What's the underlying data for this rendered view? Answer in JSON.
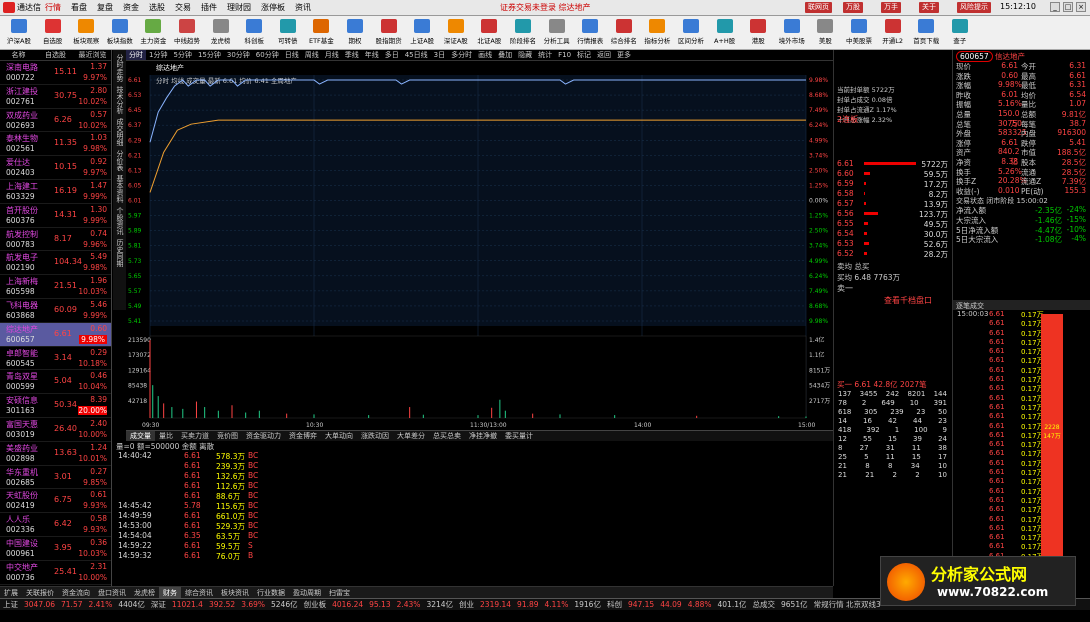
{
  "app": {
    "name": "通达信",
    "nav": "<<"
  },
  "menu": [
    "行情",
    "看盘",
    "复盘",
    "资金",
    "选股",
    "交易",
    "插件",
    "理财园",
    "涨停板",
    "资讯"
  ],
  "notice": "证券交易未登录  综达地产",
  "title_buttons": [
    "联网页",
    "万股",
    "万手",
    "关于",
    "风险提示"
  ],
  "clock": "15:12:10",
  "toolbar": [
    {
      "label": "沪深A股",
      "color": "#3a7bd5"
    },
    {
      "label": "自选股",
      "color": "#d33"
    },
    {
      "label": "板块观察",
      "color": "#e80"
    },
    {
      "label": "板块指数",
      "color": "#3a7bd5"
    },
    {
      "label": "主力资金",
      "color": "#6a4"
    },
    {
      "label": "中线趋势",
      "color": "#c44"
    },
    {
      "label": "龙虎榜",
      "color": "#888"
    },
    {
      "label": "科创板",
      "color": "#3a7bd5"
    },
    {
      "label": "可转债",
      "color": "#29a"
    },
    {
      "label": "ETF基金",
      "color": "#d60"
    },
    {
      "label": "期权",
      "color": "#3a7bd5"
    },
    {
      "label": "股指期货",
      "color": "#c33"
    },
    {
      "label": "上证A股",
      "color": "#3a7bd5"
    },
    {
      "label": "深证A股",
      "color": "#e80"
    },
    {
      "label": "北证A股",
      "color": "#c33"
    },
    {
      "label": "阶段排名",
      "color": "#29a"
    },
    {
      "label": "分析工具",
      "color": "#888"
    },
    {
      "label": "行情报表",
      "color": "#3a7bd5"
    },
    {
      "label": "综合排名",
      "color": "#c33"
    },
    {
      "label": "指标分析",
      "color": "#e80"
    },
    {
      "label": "区间分析",
      "color": "#3a7bd5"
    },
    {
      "label": "A+H股",
      "color": "#29a"
    },
    {
      "label": "港股",
      "color": "#c33"
    },
    {
      "label": "境外市场",
      "color": "#3a7bd5"
    },
    {
      "label": "美股",
      "color": "#888"
    },
    {
      "label": "中美股票",
      "color": "#3a7bd5"
    },
    {
      "label": "开通L2",
      "color": "#c33"
    },
    {
      "label": "首页下载",
      "color": "#3a7bd5"
    },
    {
      "label": "查子",
      "color": "#29a"
    }
  ],
  "leftlist": {
    "headers": [
      "名称",
      "自选股",
      "最近浏览"
    ],
    "items": [
      {
        "name": "深南电路",
        "code": "000722",
        "price": "15.11",
        "chg": "1.37",
        "pct": "9.97%"
      },
      {
        "name": "浙江建投",
        "code": "002761",
        "price": "30.75",
        "chg": "2.80",
        "pct": "10.02%"
      },
      {
        "name": "双成药业",
        "code": "002693",
        "price": "6.26",
        "chg": "0.57",
        "pct": "10.02%"
      },
      {
        "name": "泰林生物",
        "code": "002561",
        "price": "11.35",
        "chg": "1.03",
        "pct": "9.98%"
      },
      {
        "name": "爱仕达",
        "code": "002403",
        "price": "10.15",
        "chg": "0.92",
        "pct": "9.97%"
      },
      {
        "name": "上海建工",
        "code": "603329",
        "price": "16.19",
        "chg": "1.47",
        "pct": "9.99%"
      },
      {
        "name": "首开股份",
        "code": "600376",
        "price": "14.31",
        "chg": "1.30",
        "pct": "9.99%"
      },
      {
        "name": "航发控制",
        "code": "000783",
        "price": "8.17",
        "chg": "0.74",
        "pct": "9.96%"
      },
      {
        "name": "航发电子",
        "code": "002190",
        "price": "104.34",
        "chg": "5.49",
        "pct": "9.98%"
      },
      {
        "name": "上海新梅",
        "code": "605598",
        "price": "21.51",
        "chg": "1.96",
        "pct": "10.03%"
      },
      {
        "name": "飞科电器",
        "code": "603868",
        "price": "60.09",
        "chg": "5.46",
        "pct": "9.99%"
      },
      {
        "name": "综达地产",
        "code": "600657",
        "price": "6.61",
        "chg": "0.60",
        "pct": "9.98%",
        "sel": true
      },
      {
        "name": "卓郎智能",
        "code": "600545",
        "price": "3.14",
        "chg": "0.29",
        "pct": "10.18%"
      },
      {
        "name": "青岛双星",
        "code": "000599",
        "price": "5.04",
        "chg": "0.46",
        "pct": "10.04%"
      },
      {
        "name": "安硕信息",
        "code": "301163",
        "price": "50.34",
        "chg": "8.39",
        "pct": "20.00%",
        "hl": true
      },
      {
        "name": "富国天惠",
        "code": "003019",
        "price": "26.40",
        "chg": "2.40",
        "pct": "10.00%"
      },
      {
        "name": "美盛药业",
        "code": "002898",
        "price": "13.63",
        "chg": "1.24",
        "pct": "10.01%"
      },
      {
        "name": "华东重机",
        "code": "002685",
        "price": "3.01",
        "chg": "0.27",
        "pct": "9.85%"
      },
      {
        "name": "天虹股份",
        "code": "002419",
        "price": "6.75",
        "chg": "0.61",
        "pct": "9.93%"
      },
      {
        "name": "人人乐",
        "code": "002336",
        "price": "6.42",
        "chg": "0.58",
        "pct": "9.93%"
      },
      {
        "name": "中国建设",
        "code": "000961",
        "price": "3.95",
        "chg": "0.36",
        "pct": "10.03%"
      },
      {
        "name": "中交地产",
        "code": "000736",
        "price": "25.41",
        "chg": "2.31",
        "pct": "10.00%"
      },
      {
        "name": "新能泰山",
        "code": "000720",
        "price": "6.90",
        "chg": "0.68",
        "pct": "9.99%"
      }
    ]
  },
  "vtabs": [
    "分时走势",
    "技术分析",
    "成交明细",
    "分价表",
    "基本资料",
    "个股资讯",
    "历史同期"
  ],
  "timeframes": [
    "分时",
    "1分钟",
    "5分钟",
    "15分钟",
    "30分钟",
    "60分钟",
    "日线",
    "周线",
    "月线",
    "季线",
    "年线",
    "多日",
    "45日线",
    "3日",
    "多分时"
  ],
  "chart_header": {
    "name": "综达地产",
    "right": [
      "画线",
      "叠加",
      "隐藏",
      "统计",
      "F10",
      "标记",
      "返回",
      "更多"
    ]
  },
  "chart_info": "分时 均线 成交量  最新 6.61 均价 6.41  全周地产",
  "chart_data": {
    "type": "line",
    "title": "综达地产",
    "x": [
      "09:30",
      "10:30",
      "11:30/13:00",
      "14:00",
      "15:00"
    ],
    "price_ticks": [
      "6.61",
      "6.53",
      "6.45",
      "6.37",
      "6.29",
      "6.21",
      "6.13",
      "6.05",
      "6.01",
      "5.97",
      "5.89",
      "5.81",
      "5.73",
      "5.65",
      "5.57",
      "5.49",
      "5.41"
    ],
    "pct_ticks": [
      "9.98%",
      "8.68%",
      "7.49%",
      "6.24%",
      "4.99%",
      "3.74%",
      "2.50%",
      "1.25%",
      "0.00%",
      "1.25%",
      "2.50%",
      "3.74%",
      "4.99%",
      "6.24%",
      "7.49%",
      "8.68%",
      "9.98%"
    ],
    "vol_ticks": [
      "213590",
      "173072",
      "129164",
      "85438",
      "42718"
    ],
    "amt_ticks": [
      "1.4亿",
      "1.1亿",
      "8151万",
      "5434万",
      "2717万"
    ],
    "price_series": [
      [
        0,
        6.3
      ],
      [
        3,
        6.45
      ],
      [
        6,
        6.52
      ],
      [
        9,
        6.58
      ],
      [
        12,
        6.61
      ],
      [
        14,
        6.58
      ],
      [
        17,
        6.61
      ],
      [
        20,
        6.61
      ],
      [
        22,
        6.58
      ],
      [
        25,
        6.61
      ],
      [
        30,
        6.61
      ],
      [
        32,
        6.58
      ],
      [
        35,
        6.61
      ],
      [
        60,
        6.61
      ],
      [
        62,
        6.59
      ],
      [
        65,
        6.61
      ],
      [
        90,
        6.61
      ],
      [
        92,
        6.59
      ],
      [
        95,
        6.61
      ],
      [
        120,
        6.61
      ],
      [
        150,
        6.61
      ],
      [
        152,
        6.59
      ],
      [
        155,
        6.61
      ],
      [
        240,
        6.61
      ]
    ],
    "avg_series": [
      [
        0,
        6.05
      ],
      [
        5,
        6.25
      ],
      [
        10,
        6.36
      ],
      [
        15,
        6.39
      ],
      [
        25,
        6.41
      ],
      [
        60,
        6.41
      ],
      [
        120,
        6.41
      ],
      [
        240,
        6.41
      ]
    ],
    "volume": [
      [
        0,
        213590
      ],
      [
        1,
        90000
      ],
      [
        3,
        60000
      ],
      [
        5,
        40000
      ],
      [
        8,
        30000
      ],
      [
        12,
        25000
      ],
      [
        17,
        45000
      ],
      [
        20,
        30000
      ],
      [
        25,
        20000
      ],
      [
        30,
        35000
      ],
      [
        35,
        15000
      ],
      [
        40,
        20000
      ],
      [
        50,
        12000
      ],
      [
        60,
        10000
      ],
      [
        80,
        8000
      ],
      [
        95,
        30000
      ],
      [
        100,
        9000
      ],
      [
        120,
        8000
      ],
      [
        125,
        28000
      ],
      [
        128,
        50000
      ],
      [
        130,
        20000
      ],
      [
        140,
        12000
      ],
      [
        150,
        10000
      ],
      [
        170,
        8000
      ],
      [
        200,
        6000
      ],
      [
        230,
        5000
      ],
      [
        240,
        4000
      ]
    ]
  },
  "subtabs": [
    "成交量",
    "量比",
    "买卖力道",
    "竞价图",
    "资金驱动力",
    "资金博弈",
    "大单动向",
    "涨跌动因",
    "大单差分",
    "总买总卖",
    "净挂净撤",
    "委买量计"
  ],
  "trade_header": "量=0 额=500000 金额 离散",
  "trades": [
    {
      "t": "14:40:42",
      "p": "6.61",
      "v": "578.3万",
      "d": "BC"
    },
    {
      "t": "",
      "p": "6.61",
      "v": "239.3万",
      "d": "BC"
    },
    {
      "t": "",
      "p": "6.61",
      "v": "132.6万",
      "d": "BC"
    },
    {
      "t": "",
      "p": "6.61",
      "v": "112.6万",
      "d": "BC"
    },
    {
      "t": "",
      "p": "6.61",
      "v": "88.6万",
      "d": "BC"
    },
    {
      "t": "14:45:42",
      "p": "5.78",
      "v": "115.6万",
      "d": "BC"
    },
    {
      "t": "14:49:59",
      "p": "6.61",
      "v": "661.0万",
      "d": "BC"
    },
    {
      "t": "14:53:00",
      "p": "6.61",
      "v": "529.3万",
      "d": "BC"
    },
    {
      "t": "14:54:04",
      "p": "6.35",
      "v": "63.5万",
      "d": "BC"
    },
    {
      "t": "14:59:22",
      "p": "6.61",
      "v": "59.5万",
      "d": "S"
    },
    {
      "t": "14:59:32",
      "p": "6.61",
      "v": "76.0万",
      "d": "B"
    }
  ],
  "bottombar": [
    "扩展",
    "关联报价",
    "资金流向",
    "盘口资讯",
    "龙虎榜",
    "财务",
    "综合资讯",
    "板块资讯",
    "行业数据",
    "盈动周期",
    "扫雷宝"
  ],
  "midpanel": {
    "info": [
      "当前封单额 5722万",
      "封单占成交 0.08倍",
      "封单占流通Z 1.17%",
      "十日总涨幅 2.32%"
    ],
    "tag": "2连板",
    "sell_label": "卖一",
    "rows": [
      {
        "p": "6.61",
        "w": 52,
        "v": "5722万"
      },
      {
        "p": "6.60",
        "w": 6,
        "v": "59.5万"
      },
      {
        "p": "6.59",
        "w": 2,
        "v": "17.2万"
      },
      {
        "p": "6.58",
        "w": 1,
        "v": "8.2万"
      },
      {
        "p": "6.57",
        "w": 2,
        "v": "13.9万"
      },
      {
        "p": "6.56",
        "w": 14,
        "v": "123.7万"
      },
      {
        "p": "6.55",
        "w": 4,
        "v": "49.5万"
      },
      {
        "p": "6.54",
        "w": 3,
        "v": "30.0万"
      },
      {
        "p": "6.53",
        "w": 5,
        "v": "52.6万"
      },
      {
        "p": "6.52",
        "w": 3,
        "v": "28.2万"
      }
    ],
    "sum": {
      "k1": "卖均",
      "k2": "买均",
      "v1": "6.48",
      "k3": "总买",
      "v3": "7763万"
    },
    "link": "查看千档盘口",
    "buy_label": "买一",
    "buy_row": "6.61  42.8亿  2027笔",
    "buy_grid": [
      [
        "137",
        "3455",
        "242",
        "8201",
        "144"
      ],
      [
        "78",
        "2",
        "649",
        "10",
        "391"
      ],
      [
        "618",
        "305",
        "239",
        "23",
        "50"
      ],
      [
        "14",
        "16",
        "42",
        "44",
        "23"
      ],
      [
        "418",
        "392",
        "1",
        "100",
        "9"
      ],
      [
        "12",
        "55",
        "15",
        "39",
        "24"
      ],
      [
        "8",
        "27",
        "31",
        "11",
        "38"
      ],
      [
        "25",
        "5",
        "11",
        "15",
        "17"
      ],
      [
        "21",
        "8",
        "8",
        "34",
        "10"
      ],
      [
        "21",
        "21",
        "2",
        "2",
        "10"
      ]
    ]
  },
  "right": {
    "code": "600657",
    "name": "信达地产",
    "rows": [
      [
        "现价",
        "6.61",
        "今开",
        "6.31"
      ],
      [
        "涨跌",
        "0.60",
        "最高",
        "6.61"
      ],
      [
        "涨幅",
        "9.98%",
        "最低",
        "6.31"
      ],
      [
        "昨收",
        "6.01",
        "均价",
        "6.54"
      ],
      [
        "振幅",
        "5.16%",
        "量比",
        "1.07"
      ],
      [
        "总量",
        "150.0万",
        "总额",
        "9.81亿"
      ],
      [
        "总笔",
        "30750",
        "每笔",
        "38.7"
      ],
      [
        "外盘",
        "583325",
        "内盘",
        "916300"
      ]
    ],
    "rows2": [
      [
        "涨停",
        "6.61",
        "跌停",
        "5.41"
      ],
      [
        "资产",
        "840.2亿",
        "市值",
        "188.5亿"
      ],
      [
        "净资",
        "8.38",
        "股本",
        "28.5亿"
      ],
      [
        "换手",
        "5.26%",
        "流通",
        "28.5亿"
      ],
      [
        "换手Z",
        "20.28%",
        "流通Z",
        "7.39亿"
      ],
      [
        "收益(-)",
        "0.010",
        "PE(动)",
        "155.3"
      ]
    ],
    "flow_time": "交易状态 闭市阶段 15:00:02",
    "flows": [
      [
        "净流入额",
        "-2.35亿",
        "-24%"
      ],
      [
        "大宗流入",
        "-1.46亿",
        "-15%"
      ],
      [
        "5日净流入额",
        "-4.47亿",
        "-10%"
      ],
      [
        "5日大宗流入",
        "-1.08亿",
        "-4%"
      ]
    ],
    "list_header": "逐笔成交",
    "list": [
      [
        "15:00:03",
        "6.61",
        "0.17万"
      ],
      [
        "",
        "6.61",
        "0.17万"
      ],
      [
        "",
        "6.61",
        "0.17万"
      ],
      [
        "",
        "6.61",
        "0.17万"
      ],
      [
        "",
        "6.61",
        "0.17万"
      ],
      [
        "",
        "6.61",
        "0.17万"
      ],
      [
        "",
        "6.61",
        "0.17万"
      ],
      [
        "",
        "6.61",
        "0.17万"
      ],
      [
        "",
        "6.61",
        "0.17万"
      ],
      [
        "",
        "6.61",
        "0.17万"
      ],
      [
        "",
        "6.61",
        "0.17万"
      ],
      [
        "",
        "6.61",
        "0.17万"
      ],
      [
        "",
        "6.61",
        "0.17万"
      ],
      [
        "",
        "6.61",
        "0.17万"
      ],
      [
        "",
        "6.61",
        "0.17万"
      ],
      [
        "",
        "6.61",
        "0.17万"
      ],
      [
        "",
        "6.61",
        "0.17万"
      ],
      [
        "",
        "6.61",
        "0.17万"
      ],
      [
        "",
        "6.61",
        "0.17万"
      ],
      [
        "",
        "6.61",
        "0.17万"
      ],
      [
        "",
        "6.61",
        "0.17万"
      ],
      [
        "",
        "6.61",
        "0.17万"
      ],
      [
        "",
        "6.61",
        "0.17万"
      ],
      [
        "",
        "6.61",
        "0.17万"
      ],
      [
        "",
        "6.61",
        "0.17万"
      ],
      [
        "",
        "6.61",
        "0.17万"
      ],
      [
        "",
        "6.61",
        "0.17万"
      ],
      [
        "",
        "6.61",
        "0.17万"
      ]
    ],
    "redbar_label": "2228 147万"
  },
  "status": [
    {
      "t": "上证",
      "c": "#ccc"
    },
    {
      "t": "3047.06",
      "c": "#f44"
    },
    {
      "t": "71.57",
      "c": "#f44"
    },
    {
      "t": "2.41%",
      "c": "#f44"
    },
    {
      "t": "4404亿",
      "c": "#ccc"
    },
    {
      "t": "深证",
      "c": "#ccc"
    },
    {
      "t": "11021.4",
      "c": "#f44"
    },
    {
      "t": "392.52",
      "c": "#f44"
    },
    {
      "t": "3.69%",
      "c": "#f44"
    },
    {
      "t": "5246亿",
      "c": "#ccc"
    },
    {
      "t": "创业板",
      "c": "#ccc"
    },
    {
      "t": "4016.24",
      "c": "#f44"
    },
    {
      "t": "95.13",
      "c": "#f44"
    },
    {
      "t": "2.43%",
      "c": "#f44"
    },
    {
      "t": "3214亿",
      "c": "#ccc"
    },
    {
      "t": "创业",
      "c": "#ccc"
    },
    {
      "t": "2319.14",
      "c": "#f44"
    },
    {
      "t": "91.89",
      "c": "#f44"
    },
    {
      "t": "4.11%",
      "c": "#f44"
    },
    {
      "t": "1916亿",
      "c": "#ccc"
    },
    {
      "t": "科创",
      "c": "#ccc"
    },
    {
      "t": "947.15",
      "c": "#f44"
    },
    {
      "t": "44.09",
      "c": "#f44"
    },
    {
      "t": "4.88%",
      "c": "#f44"
    },
    {
      "t": "401.1亿",
      "c": "#ccc"
    },
    {
      "t": "总成交",
      "c": "#ccc"
    },
    {
      "t": "9651亿",
      "c": "#ccc"
    },
    {
      "t": "常规行情 北京双线3",
      "c": "#ccc"
    }
  ],
  "watermark": {
    "title": "分析家公式网",
    "url": "www.70822.com"
  }
}
